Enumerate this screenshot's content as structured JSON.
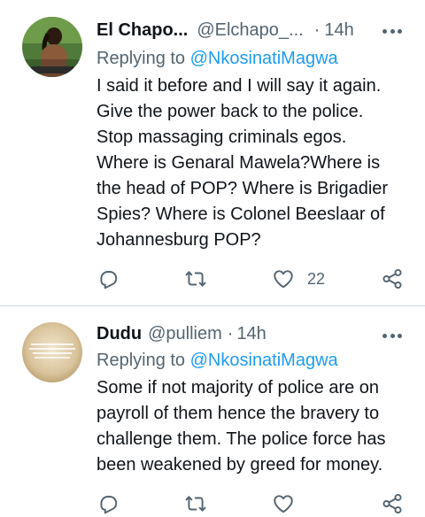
{
  "tweets": [
    {
      "author": {
        "name": "El Chapo...",
        "handle": "@Elchapo_...",
        "time": "14h"
      },
      "replying_label": "Replying to",
      "replying_to": "@NkosinatiMagwa",
      "text_lines": [
        "I said it before and I will say it again.",
        "Give the power back to the police.",
        "Stop massaging criminals egos.",
        "Where is Genaral Mawela?Where is",
        "the head of POP? Where is Brigadier",
        "Spies? Where is Colonel Beeslaar of",
        "Johannesburg POP?"
      ],
      "like_count": "22"
    },
    {
      "author": {
        "name": "Dudu",
        "handle": "@pulliem",
        "time": "14h"
      },
      "replying_label": "Replying to",
      "replying_to": "@NkosinatiMagwa",
      "text_lines": [
        "Some if not majority of police are on",
        "payroll of them hence the bravery to",
        "challenge them. The police force has",
        "been weakened by greed for money."
      ]
    }
  ],
  "separator": "·",
  "icons": [
    "more-icon",
    "reply-icon",
    "retweet-icon",
    "like-icon",
    "share-icon"
  ],
  "colors": {
    "text": "#0f1419",
    "secondary": "#536471",
    "link": "#1d9bf0",
    "border": "#cfd9de"
  }
}
